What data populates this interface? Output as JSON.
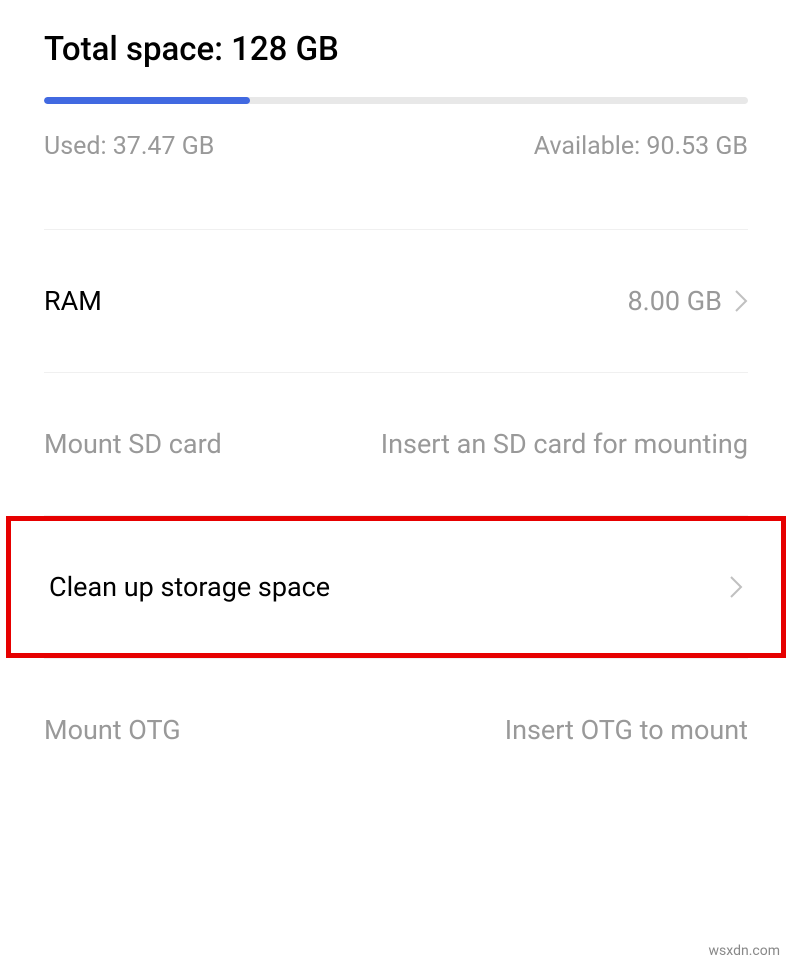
{
  "storage": {
    "total_label": "Total space: 128 GB",
    "used_label": "Used: 37.47 GB",
    "available_label": "Available: 90.53 GB",
    "used_percent": 29.3
  },
  "ram": {
    "label": "RAM",
    "value": "8.00 GB"
  },
  "sd_card": {
    "label": "Mount SD card",
    "hint": "Insert an SD card for mounting"
  },
  "cleanup": {
    "label": "Clean up storage space"
  },
  "otg": {
    "label": "Mount OTG",
    "hint": "Insert OTG to mount"
  },
  "watermark": "wsxdn.com"
}
